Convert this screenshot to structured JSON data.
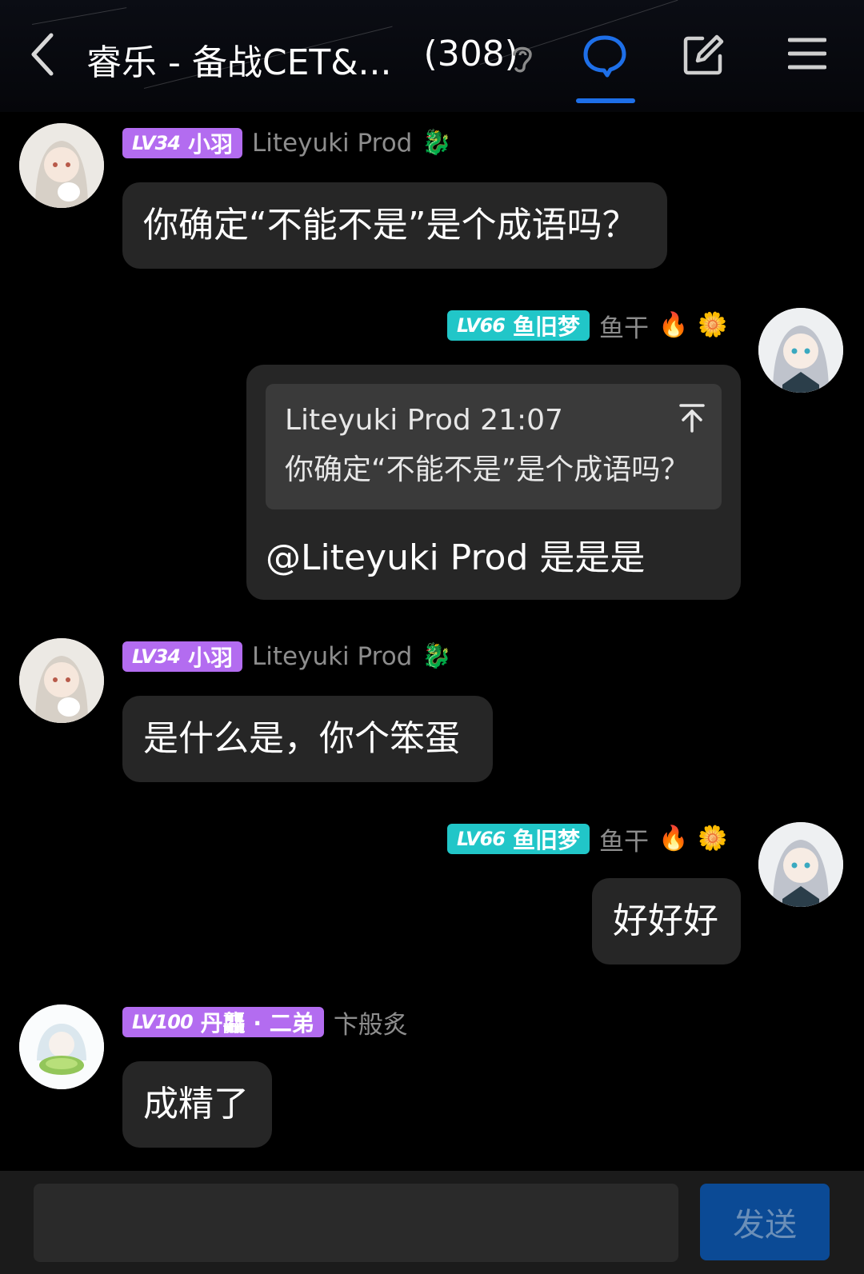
{
  "header": {
    "title": "睿乐 - 备战CET&...",
    "member_count": "(308)",
    "back_icon": "chevron-left-icon",
    "mode_icon": "ear-icon",
    "chat_icon": "chat-bubble-icon",
    "edit_icon": "edit-icon",
    "menu_icon": "hamburger-menu-icon",
    "accent_color": "#1e6fe8"
  },
  "messages": [
    {
      "side": "left",
      "level": "LV34",
      "title": "小羽",
      "badge_color": "#b36cf0",
      "nickname": "Liteyuki Prod",
      "emoji": "🐉",
      "text": "你确定“不能不是”是个成语吗？"
    },
    {
      "side": "right",
      "level": "LV66",
      "title": "鱼旧梦",
      "badge_color": "#21c6c8",
      "nickname": "鱼干",
      "emoji": "🔥",
      "emoji2": "🌼",
      "quote": {
        "author_time": "Liteyuki Prod 21:07",
        "text": "你确定“不能不是”是个成语吗？",
        "jump_icon": "arrow-to-top-icon"
      },
      "text": "@Liteyuki Prod 是是是"
    },
    {
      "side": "left",
      "level": "LV34",
      "title": "小羽",
      "badge_color": "#b36cf0",
      "nickname": "Liteyuki Prod",
      "emoji": "🐉",
      "text": "是什么是，你个笨蛋"
    },
    {
      "side": "right",
      "level": "LV66",
      "title": "鱼旧梦",
      "badge_color": "#21c6c8",
      "nickname": "鱼干",
      "emoji": "🔥",
      "emoji2": "🌼",
      "text": "好好好"
    },
    {
      "side": "left",
      "level": "LV100",
      "title": "丹龘 · 二弟",
      "badge_color": "#b36cf0",
      "nickname": "卞般炙",
      "text": "成精了"
    }
  ],
  "footer": {
    "input_value": "",
    "send_label": "发送"
  }
}
